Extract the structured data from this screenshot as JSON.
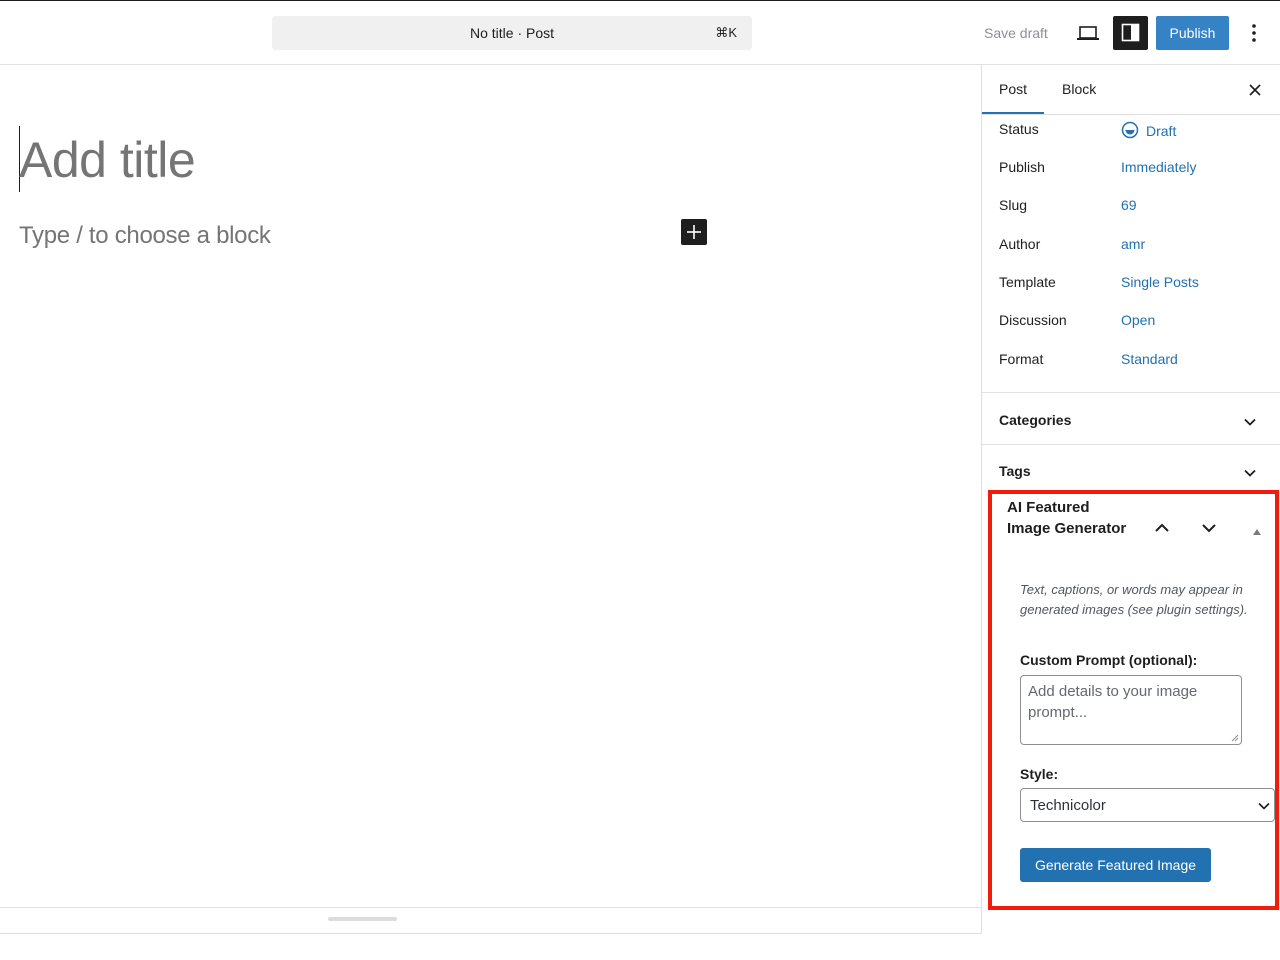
{
  "header": {
    "command_text": "No title · Post",
    "command_shortcut": "⌘K",
    "save_draft_label": "Save draft",
    "publish_label": "Publish",
    "icons": [
      "desktop-preview-icon",
      "sidebar-toggle-icon",
      "more-options-icon"
    ]
  },
  "editor": {
    "title_placeholder": "Add title",
    "block_placeholder": "Type / to choose a block"
  },
  "sidebar": {
    "tabs": [
      {
        "label": "Post",
        "active": true
      },
      {
        "label": "Block",
        "active": false
      }
    ],
    "summary": [
      {
        "label": "Status",
        "value": "Draft"
      },
      {
        "label": "Publish",
        "value": "Immediately"
      },
      {
        "label": "Slug",
        "value": "69"
      },
      {
        "label": "Author",
        "value": "amr"
      },
      {
        "label": "Template",
        "value": "Single Posts"
      },
      {
        "label": "Discussion",
        "value": "Open"
      },
      {
        "label": "Format",
        "value": "Standard"
      }
    ],
    "panels": [
      {
        "title": "Categories"
      },
      {
        "title": "Tags"
      }
    ],
    "ai": {
      "title": "AI Featured Image Generator",
      "note": "Text, captions, or words may appear in generated images (see plugin settings).",
      "prompt_label": "Custom Prompt (optional):",
      "prompt_placeholder": "Add details to your image prompt...",
      "style_label": "Style:",
      "style_value": "Technicolor",
      "generate_label": "Generate Featured Image"
    }
  },
  "colors": {
    "accent": "#2271b1",
    "publish": "#3582c4",
    "highlight": "#f21c0c"
  }
}
